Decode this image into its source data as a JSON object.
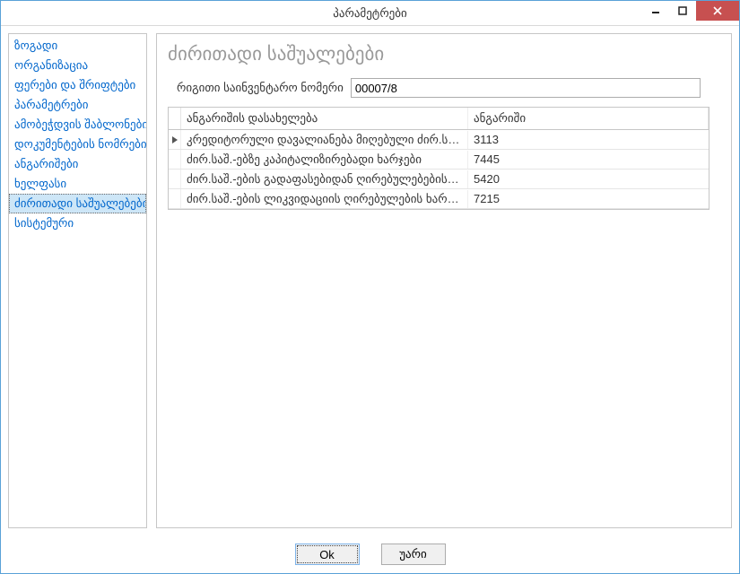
{
  "window": {
    "title": "პარამეტრები"
  },
  "sidebar": {
    "items": [
      {
        "label": "ზოგადი"
      },
      {
        "label": "ორგანიზაცია"
      },
      {
        "label": "ფერები და შრიფტები"
      },
      {
        "label": "პარამეტრები"
      },
      {
        "label": "ამობეჭდვის შაბლონები"
      },
      {
        "label": "დოკუმენტების ნომრები"
      },
      {
        "label": "ანგარიშები"
      },
      {
        "label": "ხელფასი"
      },
      {
        "label": "ძირითადი საშუალებები"
      },
      {
        "label": "სისტემური"
      }
    ],
    "selected_index": 8
  },
  "main": {
    "title": "ძირითადი საშუალებები",
    "inventory_label": "რიგითი საინვენტარო ნომერი",
    "inventory_value": "00007/8",
    "grid": {
      "columns": [
        {
          "label": "ანგარიშის დასახელება"
        },
        {
          "label": "ანგარიში"
        }
      ],
      "rows": [
        {
          "name": "კრედიტორული დავალიანება მიღებული ძირ.საშ....",
          "acc": "3113",
          "current": true
        },
        {
          "name": "ძირ.საშ.-ებზე კაპიტალიზირებადი ხარჯები",
          "acc": "7445",
          "current": false
        },
        {
          "name": "ძირ.საშ.-ების გადაფასებიდან ღირებულებების ც...",
          "acc": "5420",
          "current": false
        },
        {
          "name": "ძირ.საშ.-ების ლიკვიდაციის ღირებულების ხარჯვ...",
          "acc": "7215",
          "current": false
        }
      ]
    }
  },
  "buttons": {
    "ok": "Ok",
    "cancel": "უარი"
  }
}
